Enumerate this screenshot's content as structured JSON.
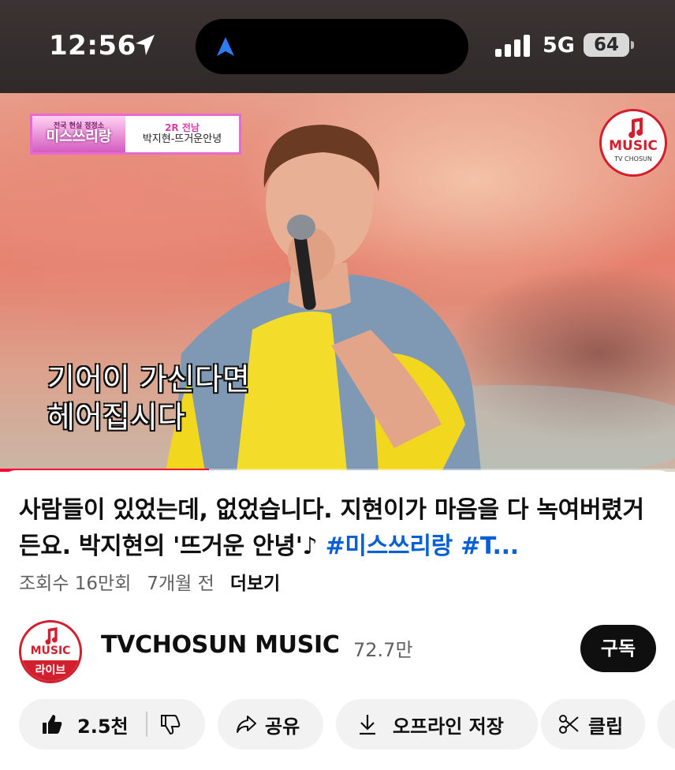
{
  "status_bar": {
    "time": "12:56",
    "network": "5G",
    "battery": "64"
  },
  "video": {
    "badge": {
      "logo_small": "전국 현실 정정소",
      "logo": "미스쓰리랑",
      "round": "2R 전남",
      "song": "박지현-뜨거운안녕"
    },
    "channel_logo": {
      "text": "MUSIC",
      "sub": "TV CHOSUN"
    },
    "subtitle_lines": [
      "기어이 가신다면",
      "헤어집시다"
    ],
    "progress_fraction": 0.31
  },
  "info": {
    "title_text": "사람들이 있었는데, 없었습니다. 지현이가 마음을 다 녹여버렸거든요. 박지현의 '뜨거운 안녕'♪ ",
    "title_hashtags": "#미스쓰리랑 #T...",
    "views": "조회수 16만회",
    "age": "7개월 전",
    "more": "더보기"
  },
  "channel": {
    "avatar_text": "MUSIC",
    "avatar_badge": "라이브",
    "name": "TVCHOSUN MUSIC",
    "subscribers": "72.7만",
    "subscribe_label": "구독"
  },
  "actions": {
    "like_count": "2.5천",
    "share_label": "공유",
    "download_label": "오프라인 저장",
    "clip_label": "클립"
  },
  "colors": {
    "accent_red": "#ff0033",
    "hashtag_blue": "#065fd4",
    "brand_red": "#d21f2d"
  }
}
